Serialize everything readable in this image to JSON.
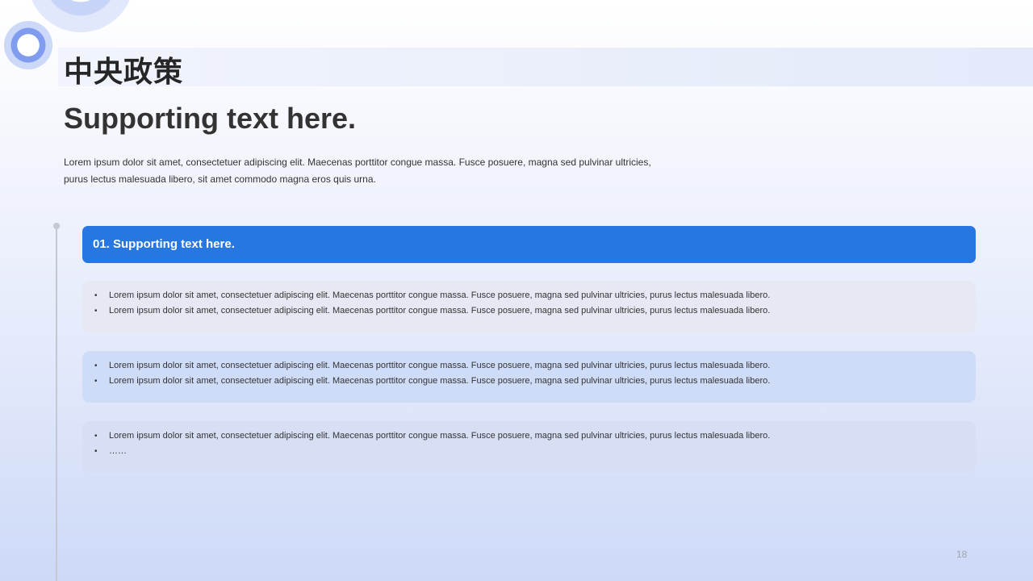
{
  "slide": {
    "title": "中央政策",
    "subtitle": "Supporting text here.",
    "intro_lines": [
      "Lorem ipsum dolor sit amet, consectetuer adipiscing elit. Maecenas porttitor congue massa. Fusce posuere, magna sed pulvinar ultricies,",
      "purus lectus malesuada libero, sit amet commodo magna eros quis urna."
    ],
    "section_header": "01. Supporting text here.",
    "cards": [
      {
        "bullets": [
          "Lorem ipsum dolor sit amet, consectetuer adipiscing elit. Maecenas porttitor congue massa. Fusce posuere, magna sed pulvinar ultricies, purus lectus malesuada libero.",
          "Lorem ipsum dolor sit amet, consectetuer adipiscing elit. Maecenas porttitor congue massa. Fusce posuere, magna sed pulvinar ultricies, purus lectus malesuada libero."
        ]
      },
      {
        "bullets": [
          "Lorem ipsum dolor sit amet, consectetuer adipiscing elit. Maecenas porttitor congue massa. Fusce posuere, magna sed pulvinar ultricies, purus lectus malesuada libero.",
          "Lorem ipsum dolor sit amet, consectetuer adipiscing elit. Maecenas porttitor congue massa. Fusce posuere, magna sed pulvinar ultricies, purus lectus malesuada libero."
        ]
      },
      {
        "bullets": [
          "Lorem ipsum dolor sit amet, consectetuer adipiscing elit. Maecenas porttitor congue massa. Fusce posuere, magna sed pulvinar ultricies, purus lectus malesuada libero.",
          "……"
        ]
      }
    ],
    "page_number": "18"
  },
  "colors": {
    "accent": "#2777e3",
    "card_gray": "#e6e9f4",
    "card_blue": "#cfdcf8",
    "card_lavender": "#d7dff5",
    "timeline": "#c4c8d2"
  },
  "icons": {
    "decoration": "concentric-circles-icon",
    "bullet": "bullet-dot-icon"
  }
}
